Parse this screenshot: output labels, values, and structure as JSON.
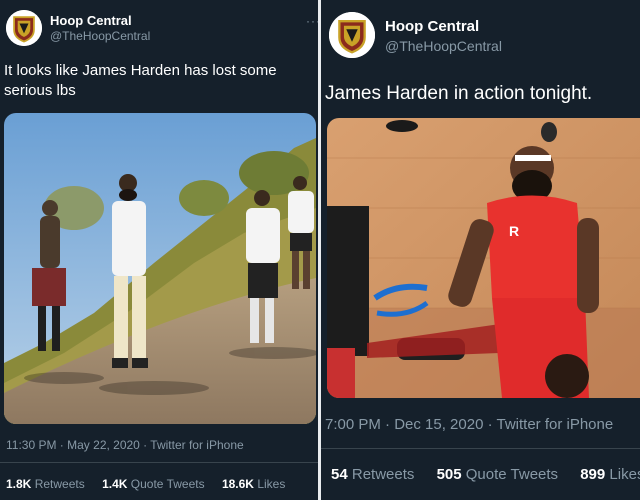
{
  "colors": {
    "background": "#15202b",
    "text": "#ffffff",
    "muted": "#8899a6",
    "divider": "#38444d"
  },
  "left_tweet": {
    "avatar_icon": "hoop-central-logo",
    "name": "Hoop Central",
    "handle": "@TheHoopCentral",
    "more_icon": "more-icon",
    "text": "It looks like James Harden has lost some serious lbs",
    "timestamp": "11:30 PM · May 22, 2020 · Twitter for iPhone",
    "stats": {
      "retweets_count": "1.8K",
      "retweets_label": "Retweets",
      "quotes_count": "1.4K",
      "quotes_label": "Quote Tweets",
      "likes_count": "18.6K",
      "likes_label": "Likes"
    }
  },
  "right_tweet": {
    "avatar_icon": "hoop-central-logo",
    "name": "Hoop Central",
    "handle": "@TheHoopCentral",
    "text": "James Harden in action tonight.",
    "timestamp": "7:00 PM · Dec 15, 2020 · Twitter for iPhone",
    "stats": {
      "retweets_count": "54",
      "retweets_label": "Retweets",
      "quotes_count": "505",
      "quotes_label": "Quote Tweets",
      "likes_count": "899",
      "likes_label": "Likes"
    }
  }
}
